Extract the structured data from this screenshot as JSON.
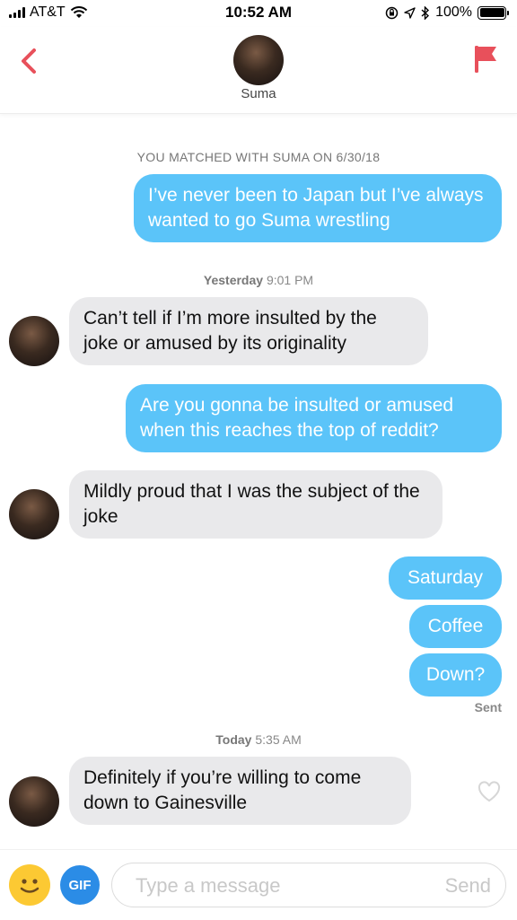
{
  "status": {
    "carrier": "AT&T",
    "time": "10:52 AM",
    "battery": "100%",
    "battery_level": 1.0
  },
  "header": {
    "name": "Suma",
    "back_icon": "chevron-left-icon",
    "flag_icon": "flag-icon"
  },
  "matched_text": "YOU MATCHED WITH SUMA ON 6/30/18",
  "timestamps": [
    {
      "day": "Yesterday",
      "time": "9:01 PM"
    },
    {
      "day": "Today",
      "time": "5:35 AM"
    }
  ],
  "messages": [
    {
      "dir": "out",
      "text": "I’ve never been to Japan but I’ve always wanted to go Suma wrestling"
    },
    {
      "dir": "in",
      "text": "Can’t tell if I’m more insulted by the joke or amused by its originality"
    },
    {
      "dir": "out",
      "text": "Are you gonna be insulted or amused when this reaches the top of reddit?"
    },
    {
      "dir": "in",
      "text": "Mildly proud that I was the subject of the joke"
    },
    {
      "dir": "out",
      "text": "Saturday"
    },
    {
      "dir": "out",
      "text": "Coffee"
    },
    {
      "dir": "out",
      "text": "Down?"
    },
    {
      "dir": "in",
      "text": "Definitely if you’re willing to come down to Gainesville"
    }
  ],
  "sent_label": "Sent",
  "composer": {
    "gif_label": "GIF",
    "placeholder": "Type a message",
    "send_label": "Send"
  },
  "colors": {
    "accent": "#e8505b",
    "outgoing": "#5bc4f9",
    "incoming": "#e9e9eb",
    "gif": "#2b8ce6",
    "emoji": "#fcc933"
  }
}
